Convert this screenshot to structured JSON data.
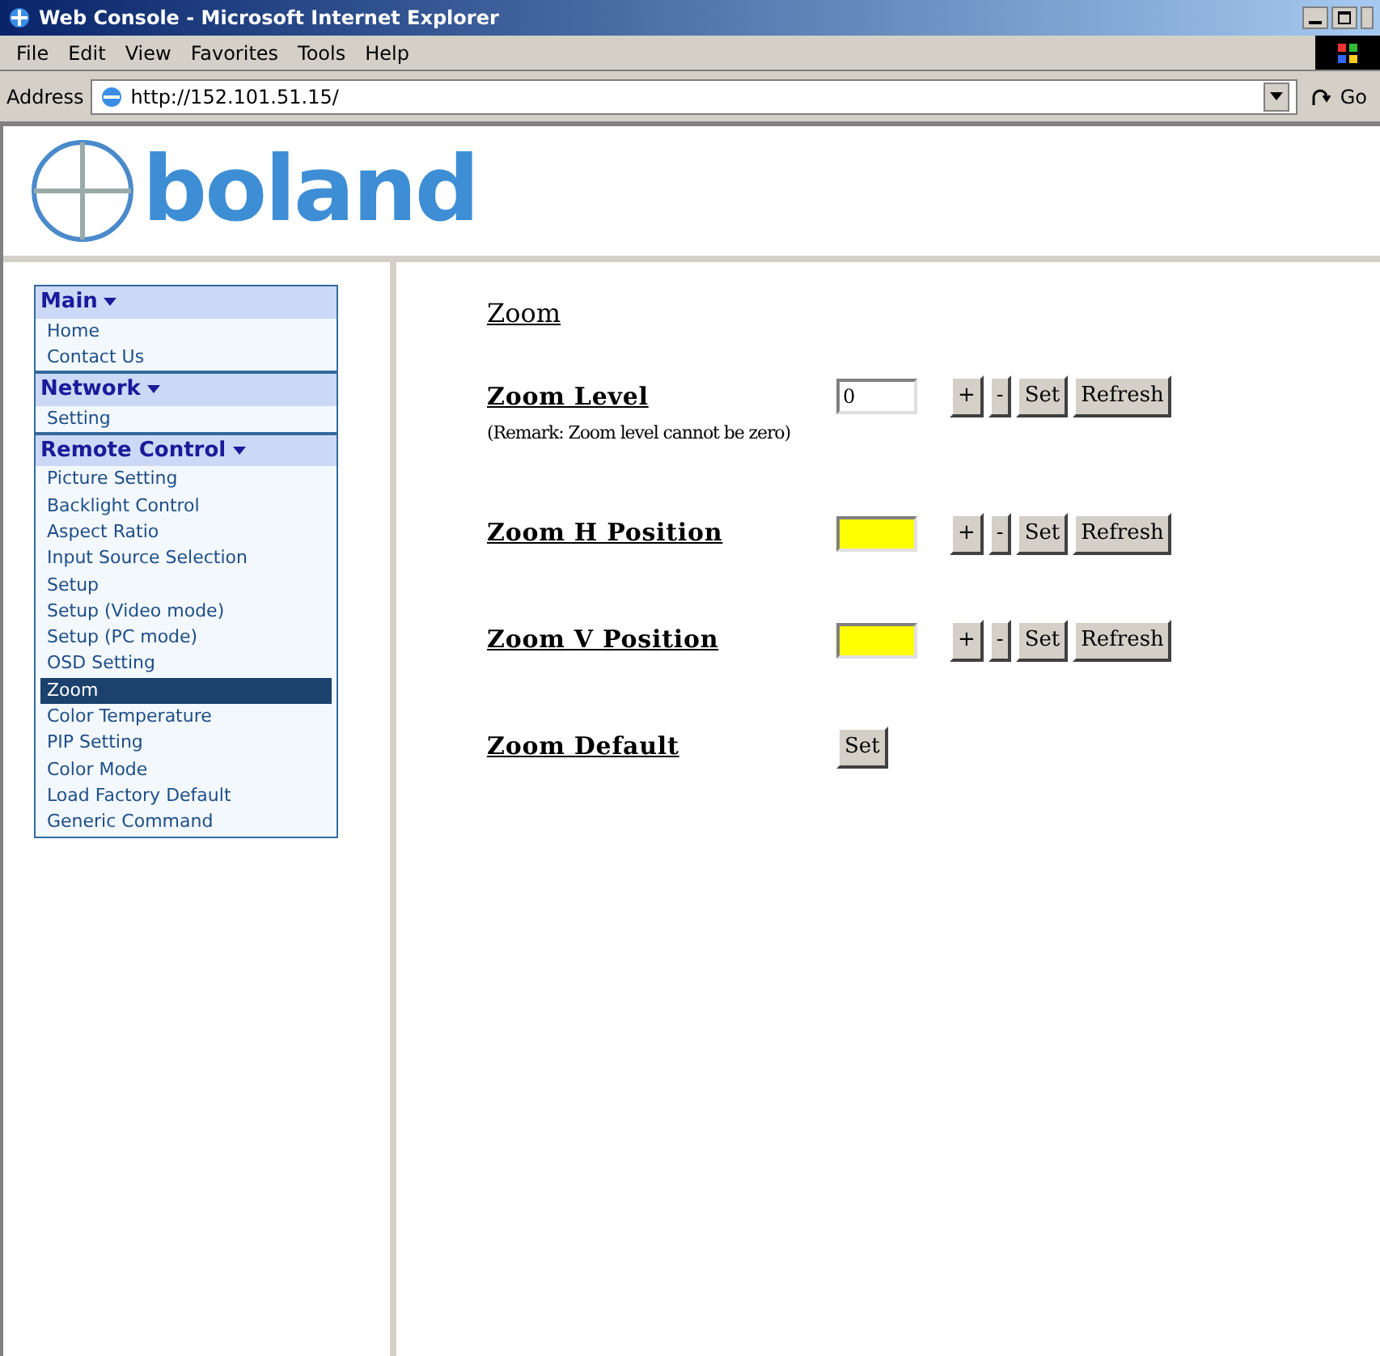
{
  "window": {
    "title": "Web Console - Microsoft Internet Explorer"
  },
  "menu": [
    "File",
    "Edit",
    "View",
    "Favorites",
    "Tools",
    "Help"
  ],
  "address": {
    "label": "Address",
    "url": "http://152.101.51.15/",
    "go": "Go"
  },
  "logo": {
    "text": "boland"
  },
  "sidebar": [
    {
      "title": "Main",
      "items": [
        {
          "label": "Home",
          "selected": false
        },
        {
          "label": "Contact Us",
          "selected": false
        }
      ]
    },
    {
      "title": "Network",
      "items": [
        {
          "label": "Setting",
          "selected": false
        }
      ]
    },
    {
      "title": "Remote Control",
      "items": [
        {
          "label": "Picture Setting",
          "selected": false
        },
        {
          "label": "Backlight Control",
          "selected": false
        },
        {
          "label": "Aspect Ratio",
          "selected": false
        },
        {
          "label": "Input Source Selection",
          "selected": false
        },
        {
          "label": "Setup",
          "selected": false
        },
        {
          "label": "Setup (Video mode)",
          "selected": false
        },
        {
          "label": "Setup (PC mode)",
          "selected": false
        },
        {
          "label": "OSD Setting",
          "selected": false
        },
        {
          "label": "Zoom",
          "selected": true
        },
        {
          "label": "Color Temperature",
          "selected": false
        },
        {
          "label": "PIP Setting",
          "selected": false
        },
        {
          "label": "Color Mode",
          "selected": false
        },
        {
          "label": "Load Factory Default",
          "selected": false
        },
        {
          "label": "Generic Command",
          "selected": false
        }
      ]
    }
  ],
  "page": {
    "title": "Zoom",
    "rows": [
      {
        "kind": "adjust",
        "label": "Zoom Level",
        "value": "0",
        "highlighted": false,
        "remark": "(Remark: Zoom level cannot be zero)",
        "buttons": [
          "+",
          "-",
          "Set",
          "Refresh"
        ]
      },
      {
        "kind": "adjust",
        "label": "Zoom H Position",
        "highlighted": true,
        "buttons": [
          "+",
          "-",
          "Set",
          "Refresh"
        ]
      },
      {
        "kind": "adjust",
        "label": "Zoom V Position",
        "highlighted": true,
        "buttons": [
          "+",
          "-",
          "Set",
          "Refresh"
        ]
      },
      {
        "kind": "action",
        "label": "Zoom Default",
        "buttons": [
          "Set"
        ]
      }
    ]
  }
}
